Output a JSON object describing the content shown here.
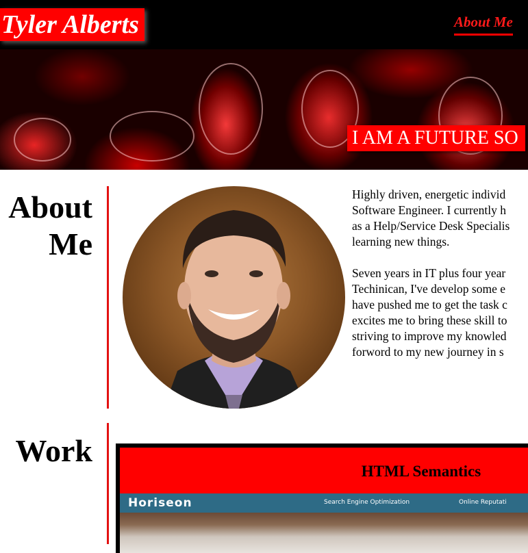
{
  "header": {
    "brand": "Tyler Alberts",
    "nav": [
      {
        "label": "About Me"
      }
    ]
  },
  "hero": {
    "banner_text": "I AM A FUTURE SO"
  },
  "about": {
    "heading_line1": "About",
    "heading_line2": "Me",
    "paragraph1_lines": [
      "Highly driven, energetic individ",
      "Software Engineer. I currently h",
      "as a Help/Service Desk Specialis",
      "learning new things."
    ],
    "paragraph2_lines": [
      "Seven years in IT plus four year",
      "Techinican, I've develop some e",
      "have pushed me to get the task c",
      "excites me to bring these skill to",
      "striving to improve my knowled",
      "forword to my new journey in s"
    ]
  },
  "work": {
    "heading": "Work",
    "projects": [
      {
        "title": "HTML Semantics",
        "screenshot": {
          "logo": "Horiseon",
          "links": [
            "Search Engine Optimization",
            "Online Reputati"
          ]
        }
      }
    ]
  },
  "colors": {
    "accent": "#ff0000",
    "header_bg": "#000000",
    "divider": "#e31111"
  }
}
